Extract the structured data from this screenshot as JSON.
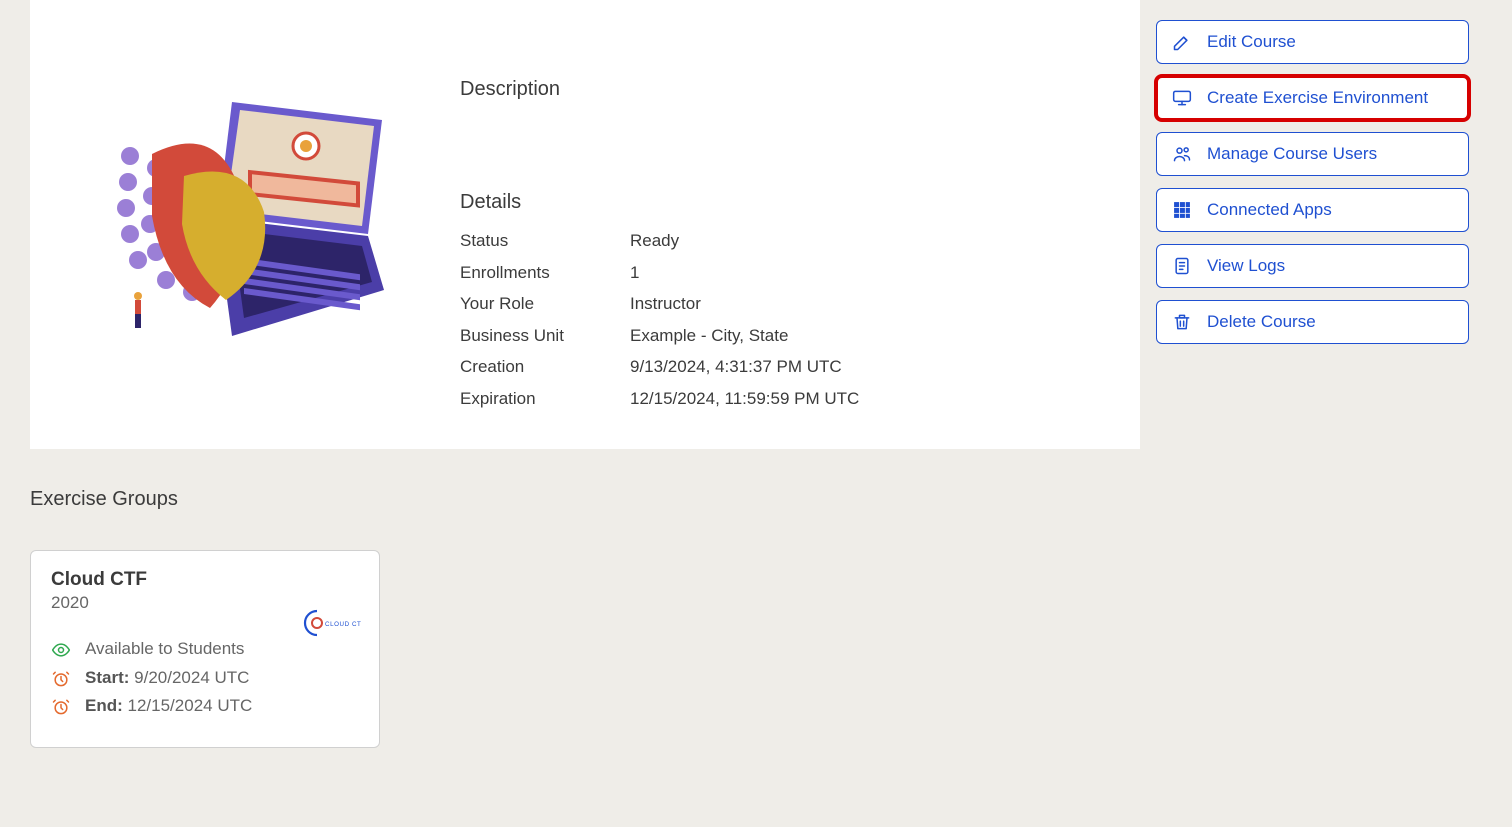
{
  "course": {
    "description_heading": "Description",
    "details_heading": "Details",
    "details": {
      "status_label": "Status",
      "status_value": "Ready",
      "enrollments_label": "Enrollments",
      "enrollments_value": "1",
      "role_label": "Your Role",
      "role_value": "Instructor",
      "bu_label": "Business Unit",
      "bu_value": "Example - City, State",
      "creation_label": "Creation",
      "creation_value": "9/13/2024, 4:31:37 PM UTC",
      "expiration_label": "Expiration",
      "expiration_value": "12/15/2024, 11:59:59 PM UTC"
    }
  },
  "actions": {
    "edit": "Edit Course",
    "create_env": "Create Exercise Environment",
    "manage_users": "Manage Course Users",
    "connected_apps": "Connected Apps",
    "view_logs": "View Logs",
    "delete": "Delete Course"
  },
  "exercise_groups": {
    "heading": "Exercise Groups",
    "card": {
      "title": "Cloud CTF",
      "subtitle": "2020",
      "logo_text": "CLOUD CTF",
      "availability": "Available to Students",
      "start_label": "Start:",
      "start_value": "9/20/2024 UTC",
      "end_label": "End:",
      "end_value": "12/15/2024 UTC"
    }
  }
}
